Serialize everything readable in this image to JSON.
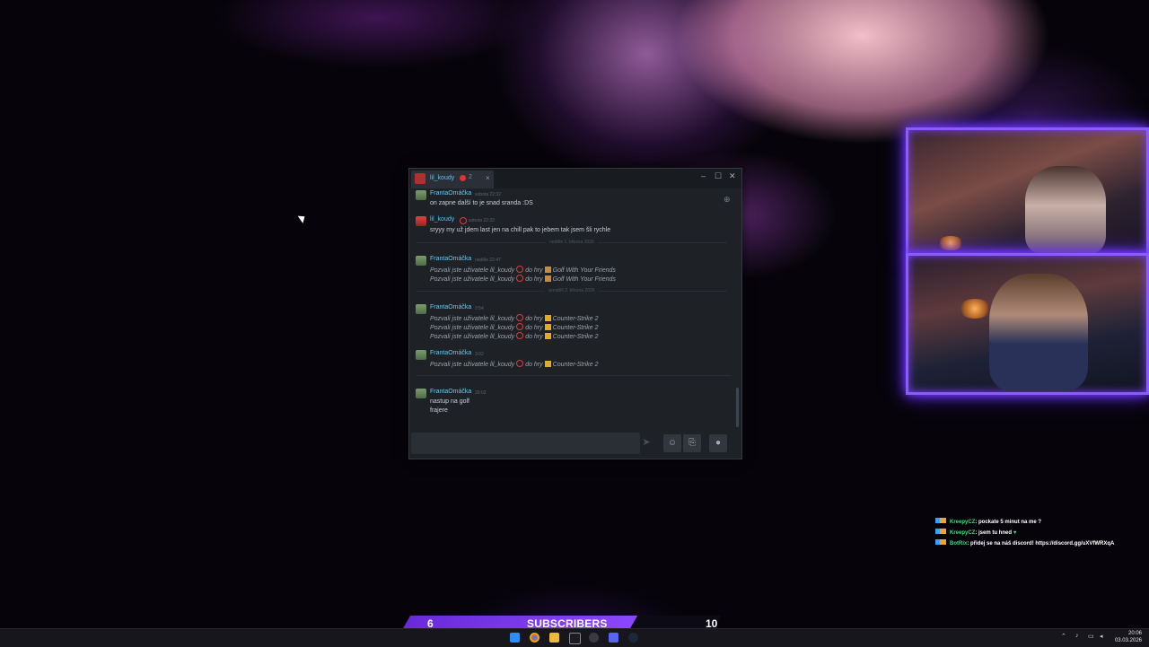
{
  "chat_window": {
    "tab": {
      "name": "lil_koudy",
      "count": "2"
    },
    "window_controls": {
      "minimize": "–",
      "maximize": "☐",
      "close": "✕"
    },
    "messages": [
      {
        "user": "FrantaOmáčka",
        "time": "sobota 22:32",
        "lines": [
          "on zapne další to je snad sranda :DS"
        ]
      },
      {
        "user": "lil_koudy",
        "time": "sobota 22:33",
        "lines": [
          "sryyy my už jdem last jen na chill pak to jebem tak jsem šli rychle"
        ]
      },
      {
        "user": "FrantaOmáčka",
        "time": "neděle 22:47",
        "lines": [
          {
            "prefix": "Pozvali jste uživatele",
            "name": "lil_koudy",
            "mid": "do hry",
            "game": "Golf With Your Friends"
          },
          {
            "prefix": "Pozvali jste uživatele",
            "name": "lil_koudy",
            "mid": "do hry",
            "game": "Golf With Your Friends"
          }
        ]
      },
      {
        "user": "FrantaOmáčka",
        "time": "2:54",
        "lines": [
          {
            "prefix": "Pozvali jste uživatele",
            "name": "lil_koudy",
            "mid": "do hry",
            "game": "Counter-Strike 2"
          },
          {
            "prefix": "Pozvali jste uživatele",
            "name": "lil_koudy",
            "mid": "do hry",
            "game": "Counter-Strike 2"
          },
          {
            "prefix": "Pozvali jste uživatele",
            "name": "lil_koudy",
            "mid": "do hry",
            "game": "Counter-Strike 2"
          }
        ]
      },
      {
        "user": "FrantaOmáčka",
        "time": "3:02",
        "lines": [
          {
            "prefix": "Pozvali jste uživatele",
            "name": "lil_koudy",
            "mid": "do hry",
            "game": "Counter-Strike 2"
          }
        ]
      },
      {
        "user": "FrantaOmáčka",
        "time": "20:02",
        "lines": [
          "nastup na golf",
          "frajere"
        ]
      }
    ],
    "day_separators": [
      "neděle 1. března 2026",
      "pondělí 2. března 2026"
    ],
    "input": {
      "placeholder": ""
    }
  },
  "overlay_chat": [
    {
      "user": "KreepyCZ",
      "text": ": pockate 5 minut na me ?"
    },
    {
      "user": "KreepyCZ",
      "text": ": jsem tu hned"
    },
    {
      "user": "BotRix",
      "text": ": přidej se na náš discord! https://discord.gg/uXVfWRXqA"
    }
  ],
  "subscribers": {
    "current": "6",
    "label": "SUBSCRIBERS",
    "goal": "10",
    "progress": 0.6
  },
  "taskbar": {
    "time": "20:06",
    "date": "03.03.2026"
  },
  "colors": {
    "accent": "#7b3cff",
    "steam_link": "#6fc4e8",
    "status_red": "#e03a3a"
  }
}
